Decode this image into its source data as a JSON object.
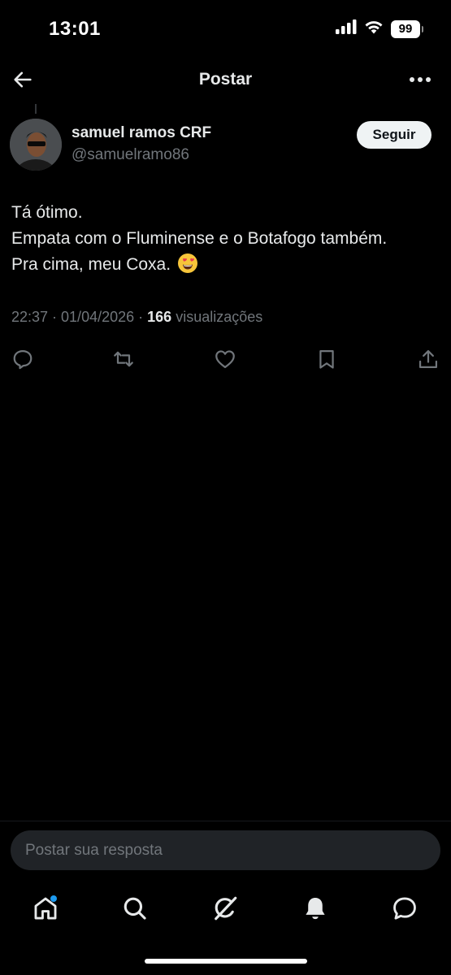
{
  "status_bar": {
    "time": "13:01",
    "battery": "99",
    "icons": [
      "signal-icon",
      "wifi-icon",
      "battery-icon"
    ]
  },
  "header": {
    "title": "Postar",
    "back_icon": "arrow-left-icon",
    "more_icon": "more-horizontal-icon"
  },
  "post": {
    "author_name": "samuel ramos CRF",
    "author_handle": "@samuelramo86",
    "follow_label": "Seguir",
    "text_lines": [
      "Tá ótimo.",
      "Empata com o Fluminense e o Botafogo também.",
      "Pra cima, meu Coxa."
    ],
    "emoji": "heart-eyes-emoji",
    "timestamp": "22:37 · 01/04/2026",
    "separator": " · ",
    "views_count": "166",
    "views_label": "visualizações"
  },
  "actions": [
    "reply-icon",
    "retweet-icon",
    "like-icon",
    "bookmark-icon",
    "share-icon"
  ],
  "reply": {
    "placeholder": "Postar sua resposta"
  },
  "bottom_nav": [
    "home-icon",
    "search-icon",
    "grok-icon",
    "notifications-icon",
    "messages-icon"
  ],
  "colors": {
    "background": "#000000",
    "text": "#e7e9ea",
    "secondary_text": "#71767b",
    "accent": "#1d9bf0",
    "follow_button_bg": "#eff3f4",
    "reply_box_bg": "#202327"
  }
}
